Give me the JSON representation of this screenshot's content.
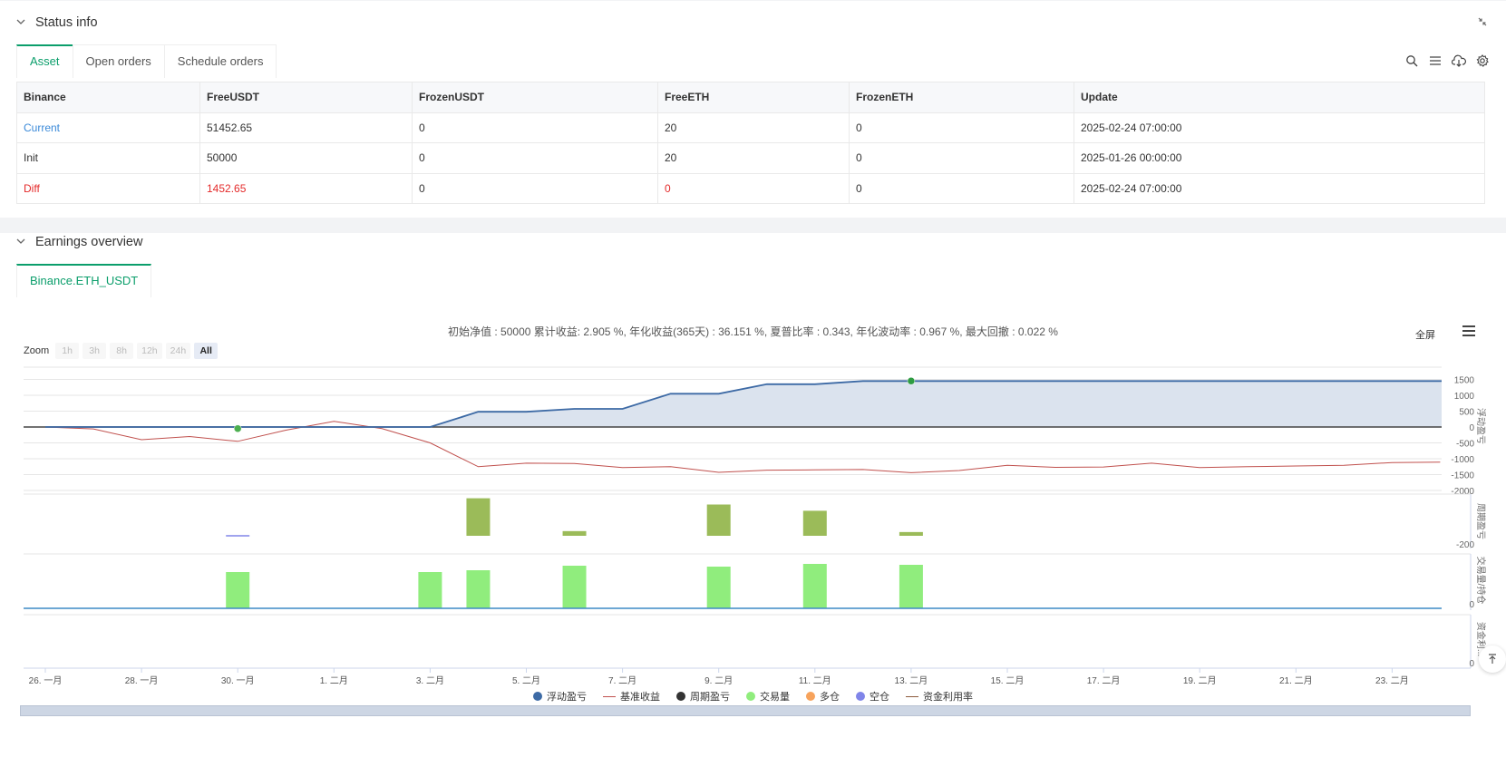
{
  "status": {
    "title": "Status info",
    "tabs": [
      "Asset",
      "Open orders",
      "Schedule orders"
    ],
    "table": {
      "headers": [
        "Binance",
        "FreeUSDT",
        "FrozenUSDT",
        "FreeETH",
        "FrozenETH",
        "Update"
      ],
      "rows": [
        [
          "Current",
          "51452.65",
          "0",
          "20",
          "0",
          "2025-02-24 07:00:00"
        ],
        [
          "Init",
          "50000",
          "0",
          "20",
          "0",
          "2025-01-26 00:00:00"
        ],
        [
          "Diff",
          "1452.65",
          "0",
          "0",
          "0",
          "2025-02-24 07:00:00"
        ]
      ]
    }
  },
  "earnings": {
    "title": "Earnings overview",
    "tab": "Binance.ETH_USDT",
    "summary": "初始净值 : 50000 累计收益: 2.905 %, 年化收益(365天) : 36.151 %, 夏普比率 : 0.343, 年化波动率 : 0.967 %, 最大回撤 : 0.022 %",
    "fullscreen": "全屏",
    "zoom_label": "Zoom",
    "zoom_buttons": [
      "1h",
      "3h",
      "8h",
      "12h",
      "24h",
      "All"
    ],
    "axis_titles": [
      "浮动盈亏",
      "周期盈亏",
      "交易量/持仓",
      "资金利..."
    ],
    "legend": [
      {
        "label": "浮动盈亏",
        "color": "#3d6aa5",
        "kind": "dot"
      },
      {
        "label": "基准收益",
        "color": "#c0504d",
        "kind": "line"
      },
      {
        "label": "周期盈亏",
        "color": "#333333",
        "kind": "dot"
      },
      {
        "label": "交易量",
        "color": "#90ed7d",
        "kind": "dot"
      },
      {
        "label": "多仓",
        "color": "#f7a35c",
        "kind": "dot"
      },
      {
        "label": "空仓",
        "color": "#8085e9",
        "kind": "dot"
      },
      {
        "label": "资金利用率",
        "color": "#8c5a3c",
        "kind": "line"
      }
    ]
  },
  "chart_data": {
    "type": "line",
    "x_tick_labels": [
      "26. 一月",
      "28. 一月",
      "30. 一月",
      "1. 二月",
      "3. 二月",
      "5. 二月",
      "7. 二月",
      "9. 二月",
      "11. 二月",
      "13. 二月",
      "15. 二月",
      "17. 二月",
      "19. 二月",
      "21. 二月",
      "23. 二月"
    ],
    "x_days": [
      0,
      2,
      4,
      6,
      8,
      10,
      12,
      14,
      16,
      18,
      20,
      22,
      24,
      26,
      28
    ],
    "panel1": {
      "y_ticks": [
        1500,
        1000,
        500,
        0,
        -500,
        -1000,
        -1500,
        -2000
      ],
      "ylim": [
        -2000,
        1700
      ],
      "series": [
        {
          "name": "浮动盈亏",
          "color": "#3d6aa5",
          "x": [
            0,
            8,
            9,
            10,
            11,
            12,
            13,
            14,
            15,
            16,
            17,
            18,
            29
          ],
          "y": [
            0,
            0,
            480,
            480,
            570,
            570,
            1050,
            1050,
            1350,
            1350,
            1450,
            1450,
            1450
          ]
        },
        {
          "name": "基准收益",
          "color": "#c0504d",
          "x": [
            0,
            1,
            2,
            3,
            4,
            5,
            6,
            7,
            8,
            9,
            10,
            11,
            12,
            13,
            14,
            15,
            16,
            17,
            18,
            19,
            20,
            21,
            22,
            23,
            24,
            25,
            26,
            27,
            28,
            29
          ],
          "y": [
            0,
            -60,
            -400,
            -300,
            -450,
            -100,
            180,
            -50,
            -500,
            -1250,
            -1140,
            -1150,
            -1280,
            -1250,
            -1430,
            -1360,
            -1350,
            -1340,
            -1440,
            -1370,
            -1210,
            -1270,
            -1260,
            -1140,
            -1280,
            -1250,
            -1230,
            -1210,
            -1120,
            -1110
          ]
        }
      ],
      "markers": [
        {
          "x": 4,
          "y": -50,
          "color": "#4caf50"
        },
        {
          "x": 18,
          "y": 1450,
          "color": "#2e9c42"
        }
      ]
    },
    "panel2": {
      "y_ticks": [
        -200
      ],
      "bars": [
        {
          "x": 9,
          "value": 120
        },
        {
          "x": 11,
          "value": 15
        },
        {
          "x": 14,
          "value": 100
        },
        {
          "x": 16,
          "value": 80
        },
        {
          "x": 18,
          "value": 12
        }
      ],
      "small_line_x": 4
    },
    "panel3": {
      "y_ticks": [
        0
      ],
      "bars": [
        {
          "x": 4,
          "value": 40
        },
        {
          "x": 8,
          "value": 40
        },
        {
          "x": 9,
          "value": 42
        },
        {
          "x": 11,
          "value": 47
        },
        {
          "x": 14,
          "value": 46
        },
        {
          "x": 16,
          "value": 49
        },
        {
          "x": 18,
          "value": 48
        }
      ]
    },
    "panel4": {
      "y_ticks": [
        0
      ]
    }
  }
}
